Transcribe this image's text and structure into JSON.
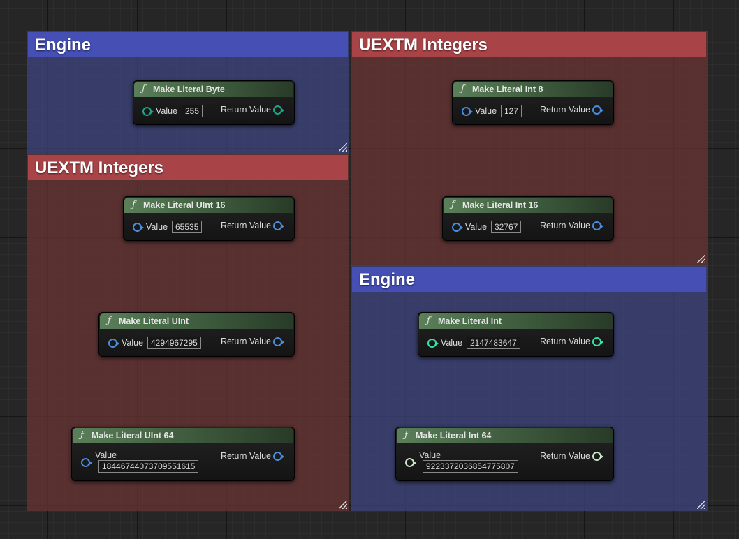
{
  "comments": {
    "engine_top": {
      "title": "Engine",
      "color": "#454fb4"
    },
    "uextm_left": {
      "title": "UEXTM Integers",
      "color": "#a84448"
    },
    "uextm_right": {
      "title": "UEXTM Integers",
      "color": "#a84448"
    },
    "engine_bottom": {
      "title": "Engine",
      "color": "#454fb4"
    }
  },
  "nodes": {
    "byte": {
      "title": "Make Literal Byte",
      "value_label": "Value",
      "value": "255",
      "output_label": "Return Value"
    },
    "uint16": {
      "title": "Make Literal UInt 16",
      "value_label": "Value",
      "value": "65535",
      "output_label": "Return Value"
    },
    "uint": {
      "title": "Make Literal UInt",
      "value_label": "Value",
      "value": "4294967295",
      "output_label": "Return Value"
    },
    "uint64": {
      "title": "Make Literal UInt 64",
      "value_label": "Value",
      "value": "18446744073709551615",
      "output_label": "Return Value"
    },
    "int8": {
      "title": "Make Literal Int 8",
      "value_label": "Value",
      "value": "127",
      "output_label": "Return Value"
    },
    "int16": {
      "title": "Make Literal Int 16",
      "value_label": "Value",
      "value": "32767",
      "output_label": "Return Value"
    },
    "int": {
      "title": "Make Literal Int",
      "value_label": "Value",
      "value": "2147483647",
      "output_label": "Return Value"
    },
    "int64": {
      "title": "Make Literal Int 64",
      "value_label": "Value",
      "value": "9223372036854775807",
      "output_label": "Return Value"
    }
  },
  "function_icon": "function-icon",
  "pin_colors": {
    "byte": "#18a889",
    "integer": "#35e3a9",
    "int64": "#c8e6c8",
    "uextm": "#4a8dde"
  }
}
